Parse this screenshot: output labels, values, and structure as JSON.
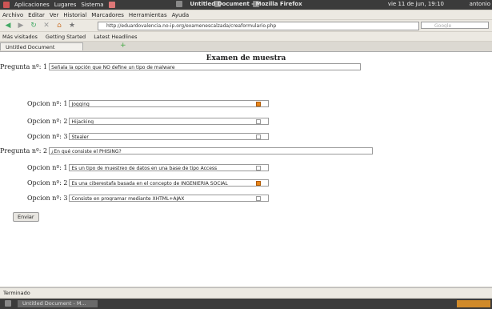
{
  "system_bar": {
    "menus": [
      "Aplicaciones",
      "Lugares",
      "Sistema"
    ],
    "window_title": "Untitled Document - Mozilla Firefox",
    "clock": "vie 11 de jun, 19:10",
    "user": "antonio"
  },
  "menubar": [
    "Archivo",
    "Editar",
    "Ver",
    "Historial",
    "Marcadores",
    "Herramientas",
    "Ayuda"
  ],
  "navbar": {
    "url": "http://eduardovalencia.no-ip.org/examenescalzada/creaformulario.php",
    "search_placeholder": "Google"
  },
  "bookmarks": [
    "Más visitados",
    "Getting Started",
    "Latest Headlines"
  ],
  "tab": {
    "label": "Untitled Document"
  },
  "page": {
    "title": "Examen de muestra",
    "submit_label": "Enviar",
    "questions": [
      {
        "label": "Pregunta nº: 1",
        "text": "Señala la opción que NO define un tipo de malware",
        "options": [
          {
            "label": "Opcion nº: 1",
            "value": "Jogging",
            "checked": true
          },
          {
            "label": "Opcion nº: 2",
            "value": "Hijacking",
            "checked": false
          },
          {
            "label": "Opcion nº: 3",
            "value": "Stealer",
            "checked": false
          }
        ]
      },
      {
        "label": "Pregunta nº: 2",
        "text": "¿En qué consiste el PHISING?",
        "options": [
          {
            "label": "Opcion nº: 1",
            "value": "Es un tipo de muestreo de datos en una base de tipo Access",
            "checked": false
          },
          {
            "label": "Opcion nº: 2",
            "value": "Es una ciberestafa basada en el concepto de INGENIERIA SOCIAL",
            "checked": true
          },
          {
            "label": "Opcion nº: 3",
            "value": "Consiste en programar mediante XHTML+AJAX",
            "checked": false
          }
        ]
      }
    ]
  },
  "status": "Terminado",
  "taskbar": {
    "item": "Untitled Document - M..."
  },
  "colors": {
    "accent_checked": "#e8861a"
  }
}
